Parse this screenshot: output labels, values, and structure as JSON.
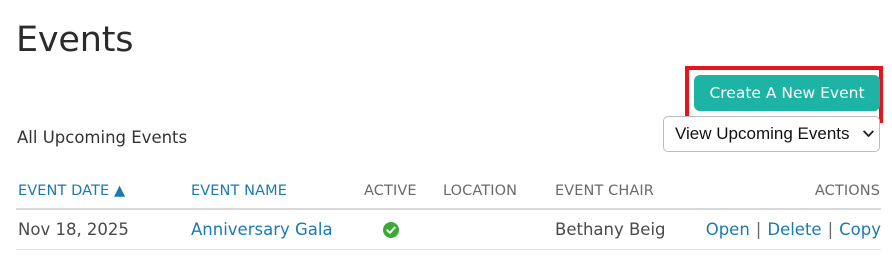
{
  "page": {
    "title": "Events"
  },
  "toolbar": {
    "create_label": "Create A New Event",
    "section_label": "All Upcoming Events",
    "view_select": {
      "selected": "View Upcoming Events"
    }
  },
  "colors": {
    "accent": "#1eb4a5",
    "highlight": "#e5151d",
    "link": "#1b7ab0",
    "active_check": "#3aaa35"
  },
  "table": {
    "headers": {
      "event_date": "EVENT DATE ▲",
      "event_name": "EVENT NAME",
      "active": "ACTIVE",
      "location": "LOCATION",
      "event_chair": "EVENT CHAIR",
      "actions": "ACTIONS"
    },
    "rows": [
      {
        "event_date": "Nov 18, 2025",
        "event_name": "Anniversary Gala",
        "active_icon": "check-circle-icon",
        "location": "",
        "event_chair": "Bethany Beig",
        "actions": {
          "open": "Open",
          "delete": "Delete",
          "copy": "Copy",
          "separator": "|"
        }
      }
    ]
  }
}
